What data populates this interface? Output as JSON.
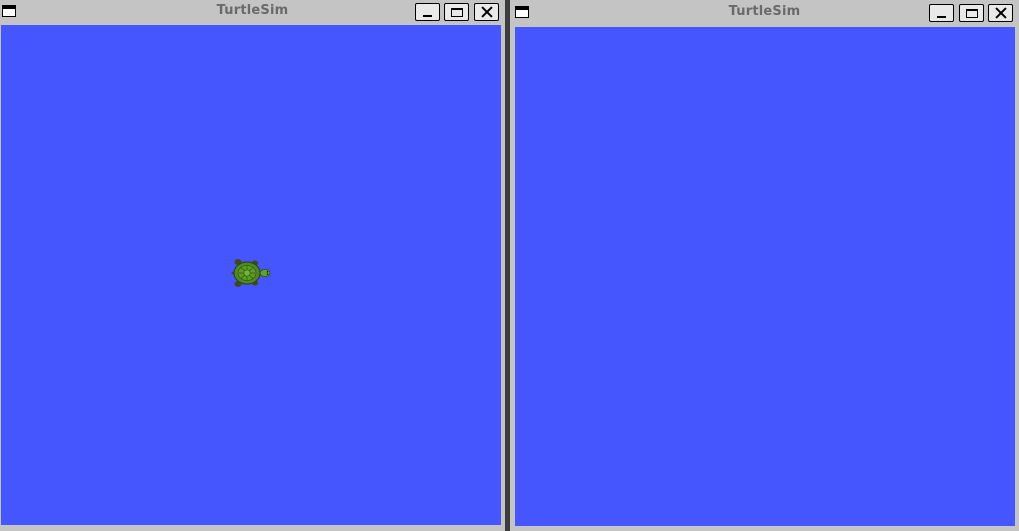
{
  "windows": [
    {
      "title": "TurtleSim",
      "canvas_color": "#4556ff",
      "turtles": [
        {
          "name": "turtle-icon",
          "heading": "east"
        }
      ]
    },
    {
      "title": "TurtleSim",
      "canvas_color": "#4556ff",
      "turtles": []
    }
  ],
  "icons": {
    "window_menu": "window-menu-icon",
    "minimize": "minimize-icon",
    "maximize": "maximize-icon",
    "close": "close-icon"
  }
}
